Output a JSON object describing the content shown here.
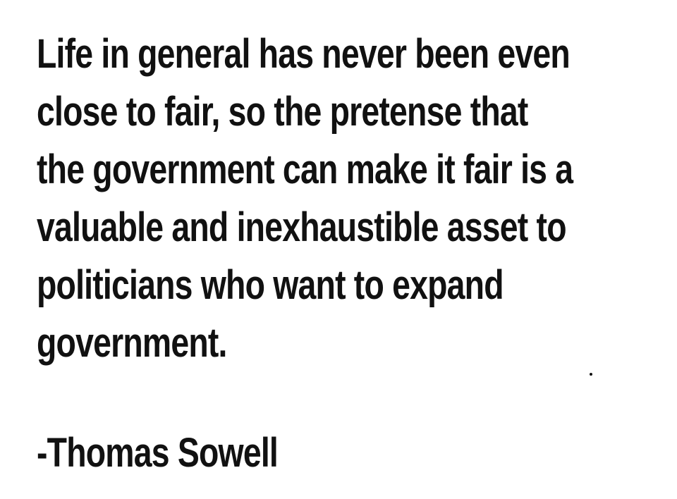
{
  "quote": {
    "lines": [
      "Life in general has never been even",
      "close to fair, so the pretense that",
      "the government can make it fair is a",
      "valuable and inexhaustible asset to",
      "politicians who want to expand",
      "government."
    ]
  },
  "attribution": "-Thomas Sowell"
}
